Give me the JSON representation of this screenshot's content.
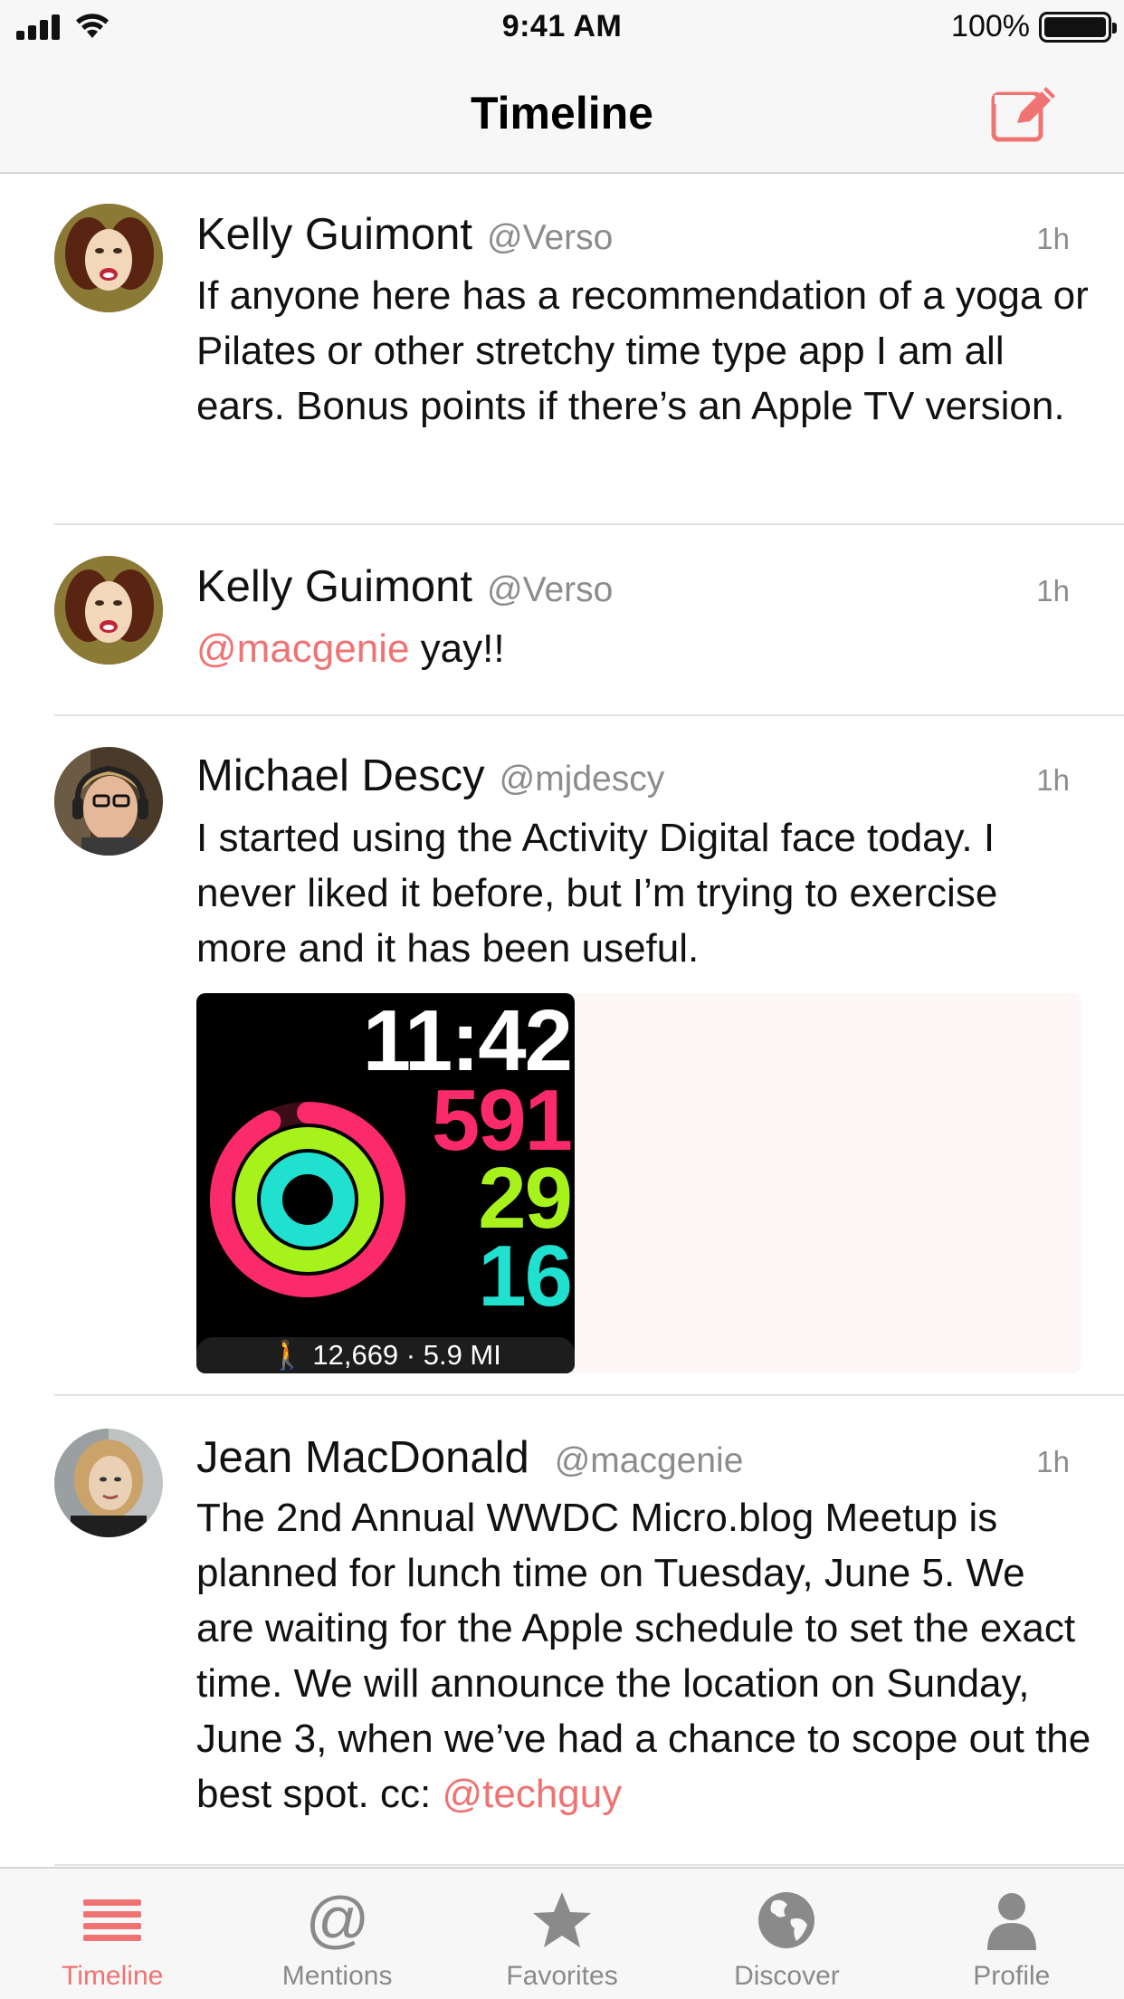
{
  "status_bar": {
    "time": "9:41 AM",
    "battery": "100%",
    "icons": [
      "cellular-signal-icon",
      "wifi-icon",
      "battery-icon"
    ]
  },
  "nav": {
    "title": "Timeline",
    "compose_icon": "compose-icon"
  },
  "colors": {
    "accent": "#f07373",
    "text": "#111111",
    "secondary": "#8c8c8c",
    "bar_background": "#f7f7f7"
  },
  "posts": [
    {
      "name": "Kelly Guimont",
      "handle": "@Verso",
      "time": "1h",
      "text": "If anyone here has a recommendation of a yoga or Pilates or other stretchy time type app I am all ears. Bonus points if there’s an Apple TV version."
    },
    {
      "name": "Kelly Guimont",
      "handle": "@Verso",
      "time": "1h",
      "mention": "@macgenie",
      "text": " yay!!"
    },
    {
      "name": "Michael Descy",
      "handle": "@mjdescy",
      "time": "1h",
      "text": "I started using the Activity Digital face today. I never liked it before, but I’m trying to exercise more and it has been useful.",
      "image": {
        "time": "11:42",
        "move": "591",
        "exercise": "29",
        "stand": "16",
        "footer": "12,669 · 5.9 MI"
      }
    },
    {
      "name": "Jean MacDonald",
      "handle": "@macgenie",
      "time": "1h",
      "text": "The 2nd Annual WWDC Micro.blog Meetup is planned for lunch time on Tuesday, June 5. We are waiting for the Apple schedule to set the exact time. We will announce the location on Sunday, June 3, when we’ve had a chance to scope out the best spot. cc: ",
      "mention": "@techguy"
    }
  ],
  "tabs": [
    {
      "label": "Timeline",
      "icon": "timeline-icon",
      "active": true
    },
    {
      "label": "Mentions",
      "icon": "at-sign-icon",
      "active": false
    },
    {
      "label": "Favorites",
      "icon": "star-icon",
      "active": false
    },
    {
      "label": "Discover",
      "icon": "globe-icon",
      "active": false
    },
    {
      "label": "Profile",
      "icon": "person-icon",
      "active": false
    }
  ]
}
